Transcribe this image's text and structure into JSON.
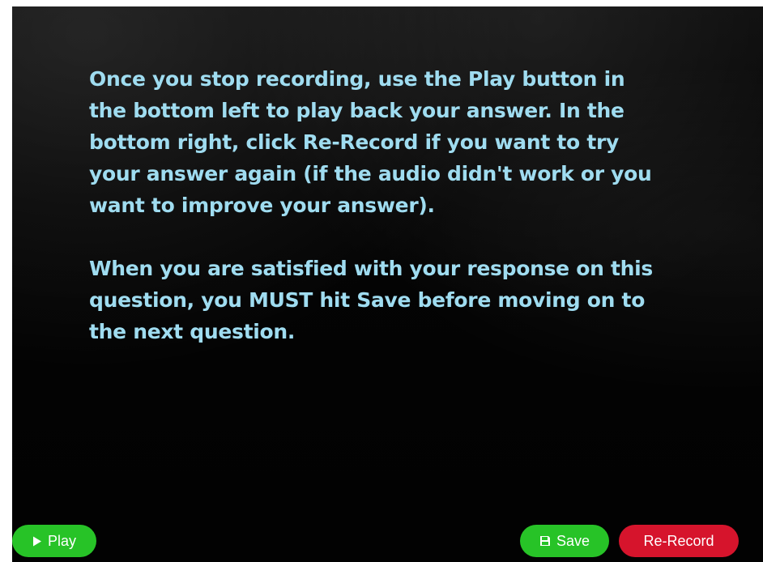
{
  "instructions": {
    "paragraph_1": "Once you stop recording, use the Play button in the bottom left to play back your answer. In the bottom right, click Re-Record if you want to try your answer again (if the audio didn't work or you want to improve your answer).",
    "paragraph_2": "When you are satisfied with your response on this question, you MUST hit Save before moving on to the next question."
  },
  "controls": {
    "play_label": "Play",
    "play_icon": "play-icon",
    "save_label": "Save",
    "save_icon": "floppy-disk-icon",
    "rerecord_label": "Re-Record"
  },
  "colors": {
    "text": "#9fdcf0",
    "background": "#050505",
    "green": "#27c327",
    "red": "#d6142c"
  }
}
